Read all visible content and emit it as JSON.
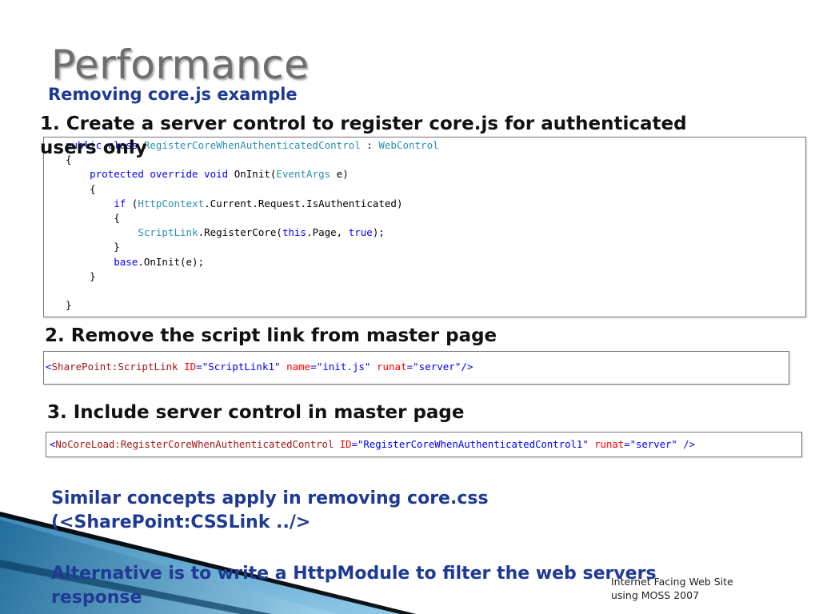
{
  "slide": {
    "title": "Performance",
    "subtitle": "Removing core.js example",
    "steps": [
      {
        "text_line1": "1. Create a server control to register core.js for authenticated",
        "text_line2": "users only"
      },
      {
        "text": "2. Remove the script link from master page"
      },
      {
        "text": "3. Include server control in master page"
      }
    ],
    "code1": [
      [
        "public class ",
        "RegisterCoreWhenAuthenticatedControl",
        " : ",
        "WebControl"
      ],
      [
        "{"
      ],
      [
        "protected override void ",
        "OnInit(",
        "EventArgs",
        " e)"
      ],
      [
        "{"
      ],
      [
        "if ",
        "(",
        "HttpContext",
        ".Current.Request.IsAuthenticated)"
      ],
      [
        "{"
      ],
      [
        "ScriptLink",
        ".RegisterCore(",
        "this",
        ".Page, ",
        "true",
        ");"
      ],
      [
        "}"
      ],
      [
        "base",
        ".OnInit(e);"
      ],
      [
        "}"
      ],
      [
        "}"
      ]
    ],
    "code2": [
      "<",
      "SharePoint:ScriptLink",
      " ",
      "ID",
      "=",
      "\"ScriptLink1\"",
      " ",
      "name",
      "=",
      "\"init.js\"",
      " ",
      "runat",
      "=",
      "\"server\"",
      "/>"
    ],
    "code3": [
      "<",
      "NoCoreLoad:RegisterCoreWhenAuthenticatedControl",
      " ",
      "ID",
      "=",
      "\"RegisterCoreWhenAuthenticatedControl1\"",
      " ",
      "runat",
      "=",
      "\"server\"",
      " />"
    ],
    "notes": [
      {
        "line1": "Similar concepts apply in removing core.css",
        "line2": "(<SharePoint:CSSLink ../>"
      },
      {
        "line1": "Alternative is to write a HttpModule to filter the web servers",
        "line2": "response"
      }
    ],
    "footer": {
      "line1": "Internet Facing Web Site",
      "line2": "using MOSS 2007"
    }
  },
  "colors": {
    "accent_blue": "#1f3a93",
    "keyword": "#0000ff",
    "type": "#2b91af",
    "tag": "#a31515",
    "attr": "#ff0000"
  }
}
